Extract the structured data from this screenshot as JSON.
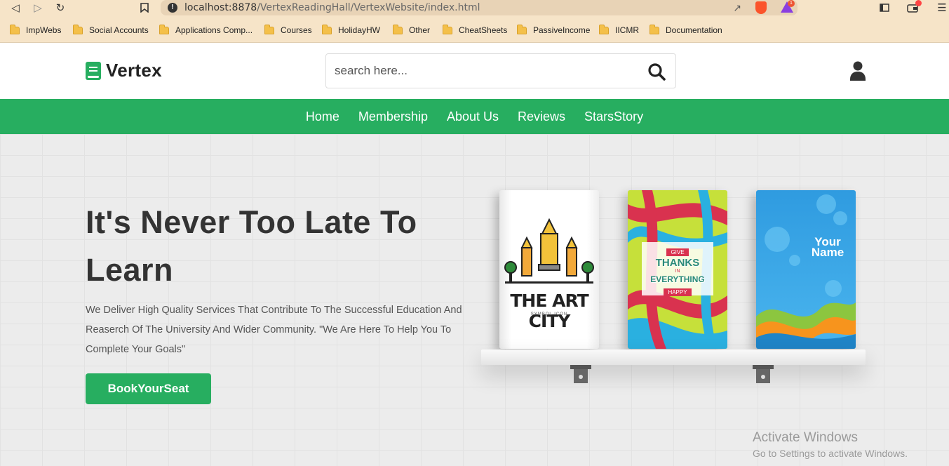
{
  "browser": {
    "url_host": "localhost:8878",
    "url_path": "/VertexReadingHall/VertexWebsite/index.html",
    "reward_badge": "1",
    "bookmarks": [
      {
        "label": "ImpWebs"
      },
      {
        "label": "Social Accounts"
      },
      {
        "label": "Applications Comp..."
      },
      {
        "label": "Courses"
      },
      {
        "label": "HolidayHW"
      },
      {
        "label": "Other"
      },
      {
        "label": "CheatSheets"
      },
      {
        "label": "PassiveIncome"
      },
      {
        "label": "IICMR"
      },
      {
        "label": "Documentation"
      }
    ]
  },
  "header": {
    "logo_text": "Vertex",
    "search_placeholder": "search here..."
  },
  "nav": {
    "items": [
      {
        "label": "Home"
      },
      {
        "label": "Membership"
      },
      {
        "label": "About Us"
      },
      {
        "label": "Reviews"
      },
      {
        "label": "StarsStory"
      }
    ]
  },
  "hero": {
    "title": "It's Never Too Late To Learn",
    "description": "We Deliver High Quality Services That Contribute To The Successful Education And Reaserch Of The University And Wider Community. \"We Are Here To Help You To Complete Your Goals\"",
    "cta_label": "BookYourSeat"
  },
  "books": {
    "book1_title": "THE ART CITY",
    "book1_subtitle": "SYMBOL ICON",
    "book2_give": "GIVE",
    "book2_thanks": "THANKS",
    "book2_in": "IN",
    "book2_everything": "EVERYTHING",
    "book2_happy": "HAPPY",
    "book3_text": "Your Name"
  },
  "watermark": {
    "line1": "Activate Windows",
    "line2": "Go to Settings to activate Windows."
  },
  "colors": {
    "brand_green": "#27ae60",
    "chrome_bg": "#f6e4c8"
  }
}
